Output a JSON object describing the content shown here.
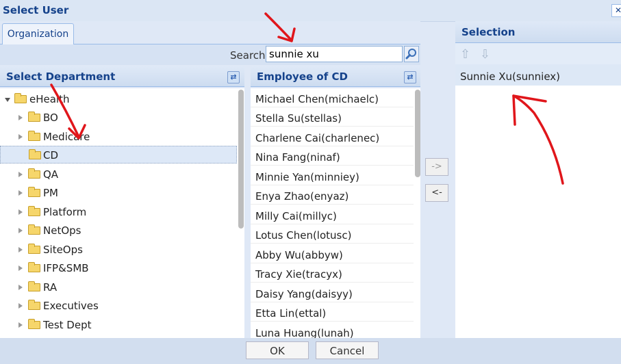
{
  "dialog": {
    "title": "Select User"
  },
  "tabs": [
    {
      "label": "Organization"
    }
  ],
  "search": {
    "label": "Search",
    "value": "sunnie xu"
  },
  "departments": {
    "header": "Select Department",
    "root": "eHealth",
    "items": [
      "BO",
      "Medicare",
      "CD",
      "QA",
      "PM",
      "Platform",
      "NetOps",
      "SiteOps",
      "IFP&SMB",
      "RA",
      "Executives",
      "Test Dept"
    ],
    "selected": "CD"
  },
  "employees": {
    "header": "Employee of CD",
    "items": [
      "Michael Chen(michaelc)",
      "Stella Su(stellas)",
      "Charlene Cai(charlenec)",
      "Nina Fang(ninaf)",
      "Minnie Yan(minniey)",
      "Enya Zhao(enyaz)",
      "Milly Cai(millyc)",
      "Lotus Chen(lotusc)",
      "Abby Wu(abbyw)",
      "Tracy Xie(tracyx)",
      "Daisy Yang(daisyy)",
      "Etta Lin(ettal)",
      "Luna Huang(lunah)"
    ]
  },
  "move": {
    "add_label": "->",
    "remove_label": "<-"
  },
  "selection": {
    "header": "Selection",
    "items": [
      "Sunnie Xu(sunniex)"
    ]
  },
  "footer": {
    "ok_label": "OK",
    "cancel_label": "Cancel"
  },
  "colors": {
    "header_text": "#15428b",
    "annotation": "#e0161b"
  }
}
